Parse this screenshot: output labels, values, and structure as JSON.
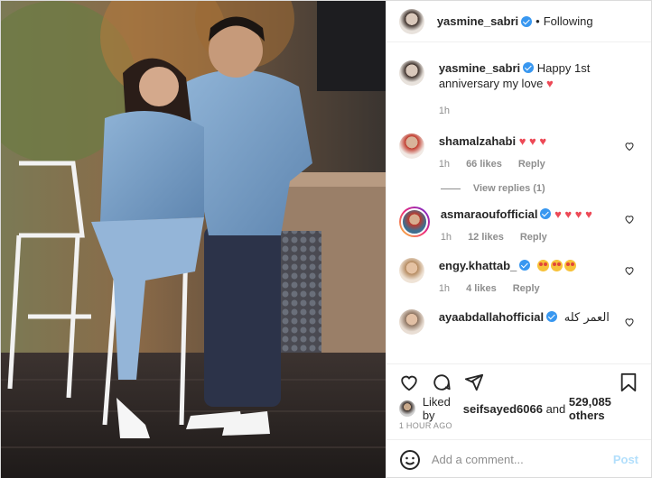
{
  "post": {
    "username": "yasmine_sabri",
    "follow_label": "Following",
    "caption_user": "yasmine_sabri",
    "caption_text": "Happy 1st anniversary my love",
    "caption_time": "1h",
    "likes_prefix": "Liked by",
    "liked_by_user": "seifsayed6066",
    "likes_and": "and",
    "likes_others": "529,085 others",
    "time_ago": "1 HOUR AGO",
    "comment_placeholder": "Add a comment...",
    "post_label": "Post"
  },
  "comments": [
    {
      "user": "shamalzahabi",
      "verified": false,
      "hearts": 3,
      "time": "1h",
      "likes": "66 likes",
      "reply": "Reply",
      "view_replies": "View replies (1)"
    },
    {
      "user": "asmaraoufofficial",
      "verified": true,
      "hearts": 4,
      "time": "1h",
      "likes": "12 likes",
      "reply": "Reply"
    },
    {
      "user": "engy.khattab_",
      "verified": true,
      "emojis": 3,
      "time": "1h",
      "likes": "4 likes",
      "reply": "Reply"
    },
    {
      "user": "ayaabdallahofficial",
      "verified": true,
      "text": "العمر كله"
    }
  ],
  "icons": [
    "heart-icon",
    "comment-icon",
    "share-icon",
    "bookmark-icon",
    "smile-icon",
    "verified-icon"
  ],
  "colors": {
    "heart": "#ed4956",
    "verified": "#3897f0",
    "post_disabled": "#b2dffc"
  }
}
